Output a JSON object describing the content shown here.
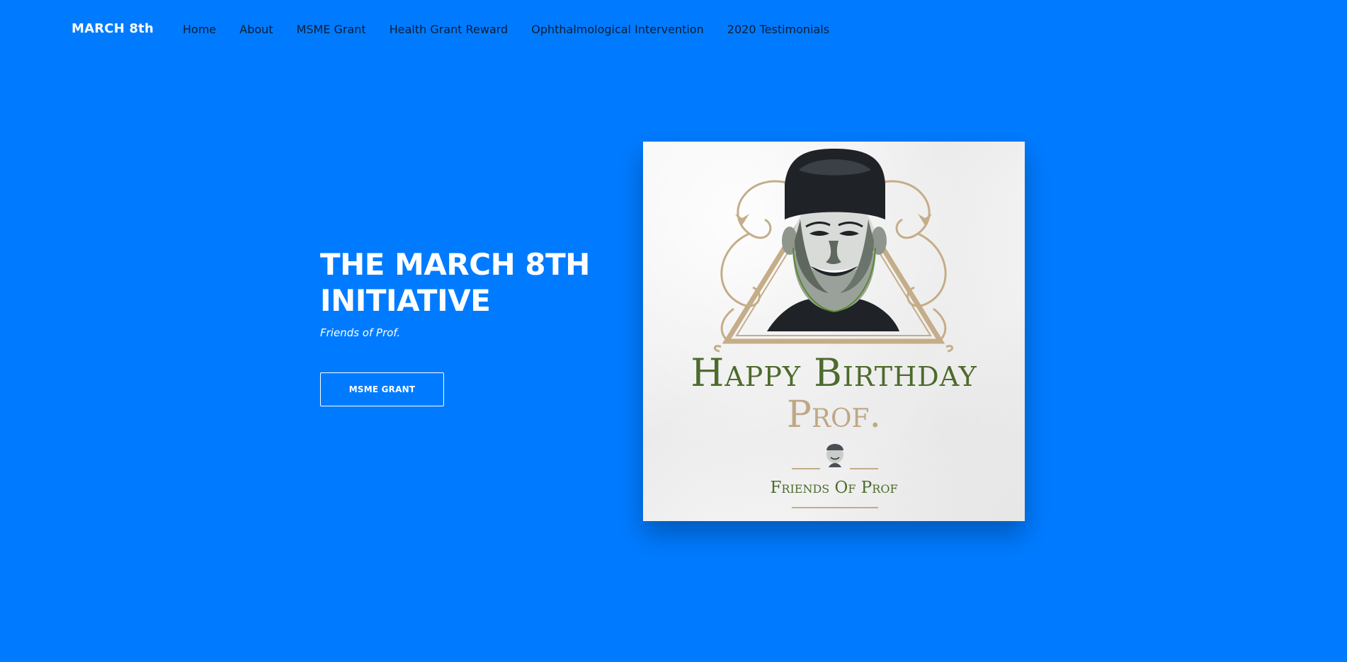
{
  "brand": {
    "name": "MARCH 8th"
  },
  "nav": {
    "items": [
      {
        "label": "Home"
      },
      {
        "label": "About"
      },
      {
        "label": "MSME Grant"
      },
      {
        "label": "Health Grant Reward"
      },
      {
        "label": "Ophthalmological Intervention"
      },
      {
        "label": "2020 Testimonials"
      }
    ]
  },
  "hero": {
    "title_line1": "THE MARCH 8TH",
    "title_line2": "INITIATIVE",
    "subtitle": "Friends of Prof.",
    "cta_label": "MSME GRANT"
  },
  "poster": {
    "happy_text": "Happy Birthday",
    "prof_text": "Prof.",
    "friends_text": "Friends Of Prof",
    "portrait_icon": "portrait-illustration-icon",
    "colors": {
      "green": "#4d6b2c",
      "gold": "#bfa886",
      "cap": "#1f2328"
    }
  },
  "theme": {
    "background": "#007bff",
    "nav_text": "#0b1d33",
    "hero_text": "#ffffff"
  }
}
